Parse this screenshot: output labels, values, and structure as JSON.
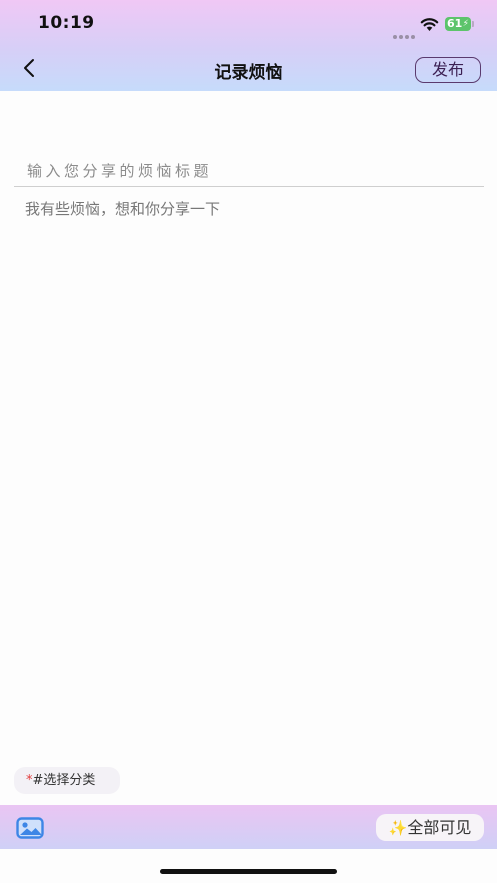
{
  "status_bar": {
    "time": "10:19",
    "battery": "61"
  },
  "nav": {
    "title": "记录烦恼",
    "publish_label": "发布"
  },
  "form": {
    "title_placeholder": "输入您分享的烦恼标题",
    "content_placeholder": "我有些烦恼，想和你分享一下"
  },
  "category": {
    "required_mark": "*",
    "label": "#选择分类"
  },
  "bottom_bar": {
    "image_icon": "image-icon",
    "visibility_label": "全部可见",
    "sparkle": "✨"
  },
  "colors": {
    "accent": "#5a3a6e",
    "battery": "#5cc46b",
    "required": "#e23a3a"
  }
}
